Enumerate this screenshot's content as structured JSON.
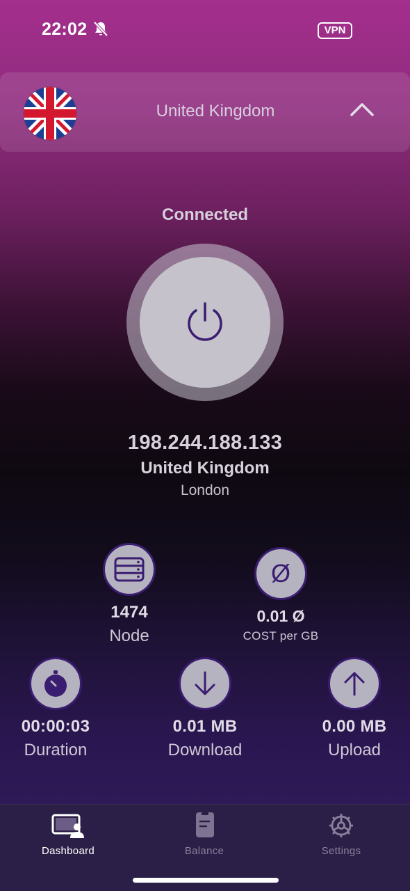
{
  "status_bar": {
    "time": "22:02",
    "vpn_badge": "VPN"
  },
  "country_selector": {
    "country": "United Kingdom"
  },
  "connection": {
    "status": "Connected"
  },
  "location": {
    "ip": "198.244.188.133",
    "country": "United Kingdom",
    "city": "London"
  },
  "stats": {
    "node": {
      "value": "1474",
      "label": "Node"
    },
    "cost": {
      "symbol": "Ø",
      "value": "0.01 Ø",
      "label": "COST per GB"
    },
    "duration": {
      "value": "00:00:03",
      "label": "Duration"
    },
    "download": {
      "value": "0.01 MB",
      "label": "Download"
    },
    "upload": {
      "value": "0.00 MB",
      "label": "Upload"
    }
  },
  "tabs": [
    {
      "label": "Dashboard",
      "icon": "dashboard-icon",
      "active": true
    },
    {
      "label": "Balance",
      "icon": "balance-icon",
      "active": false
    },
    {
      "label": "Settings",
      "icon": "settings-icon",
      "active": false
    }
  ],
  "colors": {
    "accent": "#3a1d70",
    "tab_bar": "#2c1f47"
  }
}
